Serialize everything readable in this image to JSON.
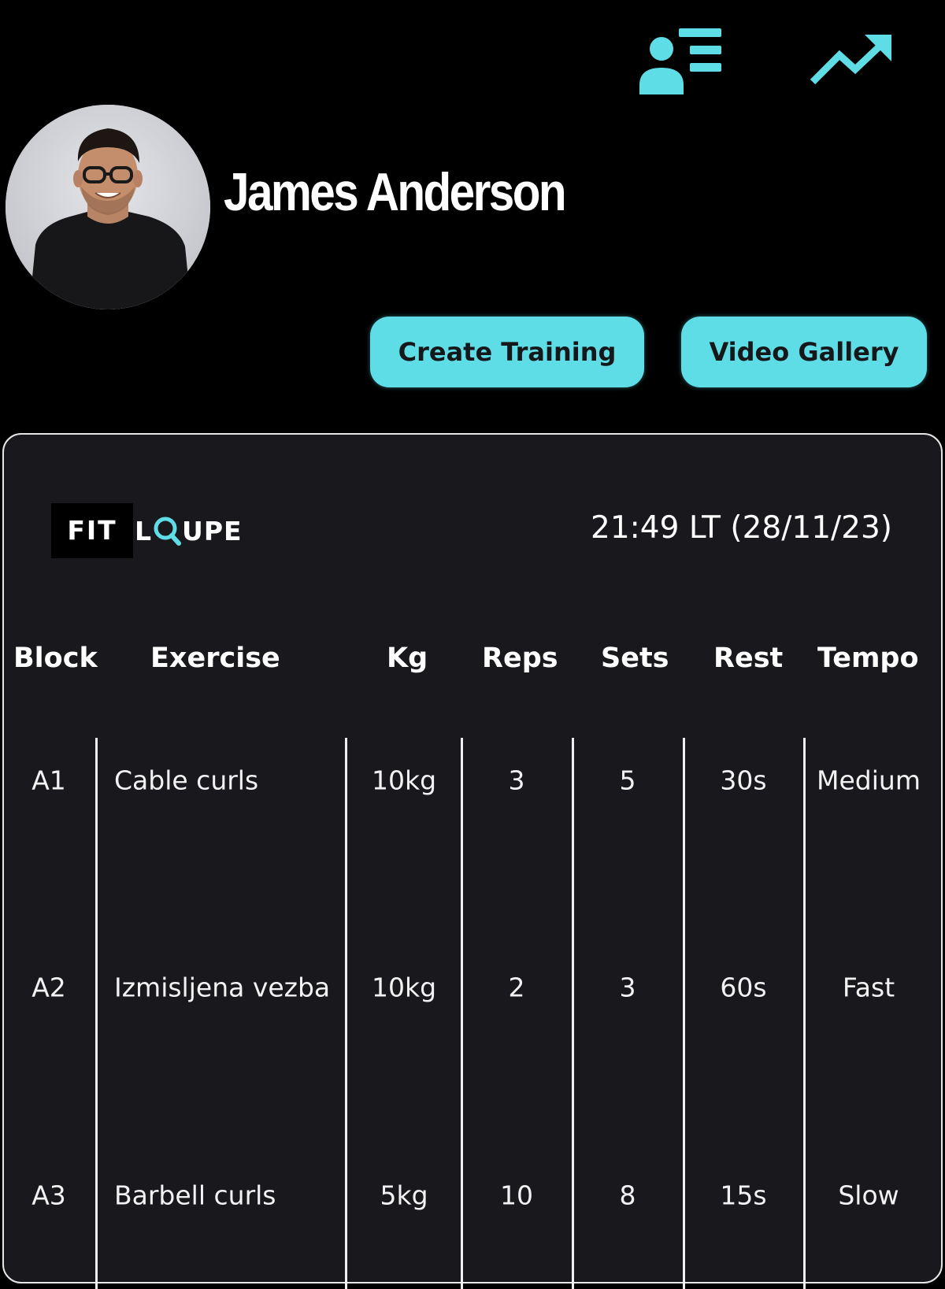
{
  "header": {
    "icons": {
      "client_list": "client-list-icon",
      "progress": "progress-trend-icon"
    },
    "accent_color": "#5fdde6"
  },
  "profile": {
    "name": "James Anderson",
    "avatar": "profile-photo"
  },
  "actions": {
    "create_training": "Create Training",
    "video_gallery": "Video Gallery"
  },
  "card": {
    "logo": {
      "part1": "FIT",
      "part2_prefix": "L",
      "part2_suffix": "UPE"
    },
    "timestamp": "21:49 LT (28/11/23)",
    "table": {
      "headers": [
        "Block",
        "Exercise",
        "Kg",
        "Reps",
        "Sets",
        "Rest",
        "Tempo"
      ],
      "rows": [
        [
          "A1",
          "Cable curls",
          "10kg",
          "3",
          "5",
          "30s",
          "Medium"
        ],
        [
          "A2",
          "Izmisljena vezba",
          "10kg",
          "2",
          "3",
          "60s",
          "Fast"
        ],
        [
          "A3",
          "Barbell curls",
          "5kg",
          "10",
          "8",
          "15s",
          "Slow"
        ]
      ]
    }
  }
}
